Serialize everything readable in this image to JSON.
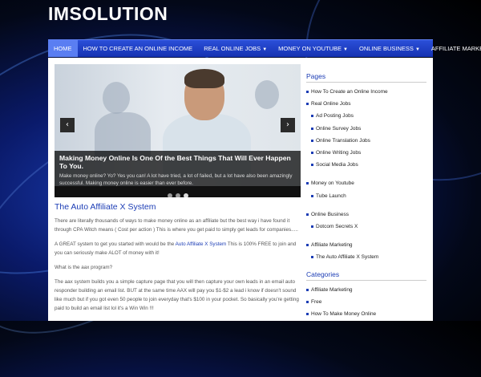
{
  "site": {
    "title": "IMSOLUTION"
  },
  "nav": [
    {
      "label": "HOME",
      "dropdown": false,
      "active": true
    },
    {
      "label": "HOW TO CREATE AN ONLINE INCOME",
      "dropdown": false,
      "active": false
    },
    {
      "label": "REAL ONLINE JOBS",
      "dropdown": true,
      "active": false
    },
    {
      "label": "MONEY ON YOUTUBE",
      "dropdown": true,
      "active": false
    },
    {
      "label": "ONLINE BUSINESS",
      "dropdown": true,
      "active": false
    },
    {
      "label": "AFFILIATE MARKETING",
      "dropdown": true,
      "active": false
    }
  ],
  "slider": {
    "title": "Making Money Online Is One Of the Best Things That Will Ever Happen To You.",
    "text": "Make money online? Yo? Yes you can! A lot have tried, a lot of failed, but a lot have also been amazingly successful. Making money online is easier than ever before.",
    "prev_icon": "‹",
    "next_icon": "›"
  },
  "post": {
    "title": "The Auto Affiliate X System",
    "p1": "There are literally thousands of ways to make money online as an affiliate but the best way i have found it through CPA Witch means ( Cost per action ) This is where you get paid to simply get leads for companies.....",
    "p2_before": "A GREAT system to get you started with would be the ",
    "p2_link": "Auto Affiliate X System",
    "p2_after": " This is 100% FREE to join and you can seriously make ALOT of money with it!",
    "p3": "What is the aax program?",
    "p4": "The aax system builds you a simple capture page that you will then capture your own leads in an email auto responder building an email list. BUT at the same time AAX will pay you $1-$2 a lead i know if doesn't sound like much but if you got even 50 people to join everyday that's $100 in your pocket. So basically you're getting paid to build an email list lol it's a Win Win !!!"
  },
  "sidebar": {
    "pages_heading": "Pages",
    "pages": {
      "create_income": "How To Create an Online Income",
      "real_jobs": "Real Online Jobs",
      "ad_posting": "Ad Posting Jobs",
      "survey": "Online Survey Jobs",
      "translation": "Online Translation Jobs",
      "writing": "Online Writing Jobs",
      "social_media": "Social Media Jobs",
      "money_youtube": "Money on Youtube",
      "tube_launch": "Tube Launch",
      "online_business": "Online Business",
      "dotcom": "Dotcom Secrets X",
      "affiliate": "Affiliate Marketing",
      "aax": "The Auto Affiliate X System"
    },
    "categories_heading": "Categories",
    "categories": {
      "affiliate": "Affiliate Marketing",
      "free": "Free",
      "how_to": "How To Make Money Online"
    }
  }
}
